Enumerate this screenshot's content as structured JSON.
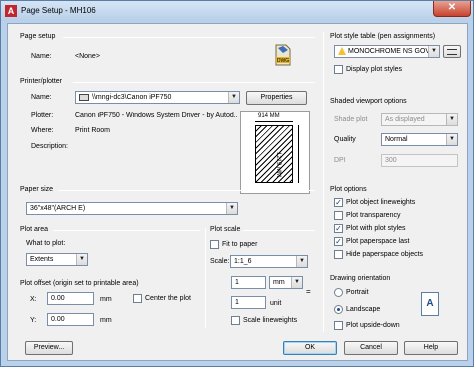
{
  "window": {
    "app_icon": "A",
    "title": "Page Setup - MH106",
    "close_icon": "✕"
  },
  "page_setup": {
    "group_title": "Page setup",
    "name_label": "Name:",
    "name_value": "<None>",
    "dwg_icon_text": "DWG"
  },
  "printer": {
    "group_title": "Printer/plotter",
    "name_label": "Name:",
    "name_value": "\\\\mngi-dc3\\Canon iPF750",
    "properties_label": "Properties",
    "plotter_label": "Plotter:",
    "plotter_value": "Canon iPF750 - Windows System Driver - by Autod...",
    "where_label": "Where:",
    "where_value": "Print Room",
    "description_label": "Description:",
    "dim_width": "914 MM",
    "dim_height": "1219 MM"
  },
  "paper_size": {
    "group_title": "Paper size",
    "value": "36\"x48\"(ARCH E)"
  },
  "plot_area": {
    "group_title": "Plot area",
    "what_label": "What to plot:",
    "what_value": "Extents"
  },
  "plot_offset": {
    "group_title": "Plot offset (origin set to printable area)",
    "x_label": "X:",
    "x_value": "0.00",
    "x_unit": "mm",
    "y_label": "Y:",
    "y_value": "0.00",
    "y_unit": "mm",
    "center_label": "Center the plot"
  },
  "plot_scale": {
    "group_title": "Plot scale",
    "fit_label": "Fit to paper",
    "scale_label": "Scale:",
    "scale_value": "1:1_6",
    "value1": "1",
    "unit1": "mm",
    "equals": "=",
    "value2": "1",
    "unit2": "unit",
    "lineweights_label": "Scale lineweights"
  },
  "plot_style_table": {
    "group_title": "Plot style table (pen assignments)",
    "value": "MONOCHROME NS GOV",
    "display_label": "Display plot styles"
  },
  "shaded_viewport": {
    "group_title": "Shaded viewport options",
    "shade_label": "Shade plot",
    "shade_value": "As displayed",
    "quality_label": "Quality",
    "quality_value": "Normal",
    "dpi_label": "DPI",
    "dpi_value": "300"
  },
  "plot_options": {
    "group_title": "Plot options",
    "items": [
      {
        "label": "Plot object lineweights",
        "checked": true
      },
      {
        "label": "Plot transparency",
        "checked": false
      },
      {
        "label": "Plot with plot styles",
        "checked": true
      },
      {
        "label": "Plot paperspace last",
        "checked": true
      },
      {
        "label": "Hide paperspace objects",
        "checked": false
      }
    ]
  },
  "orientation": {
    "group_title": "Drawing orientation",
    "portrait_label": "Portrait",
    "landscape_label": "Landscape",
    "upside_down_label": "Plot upside-down",
    "icon_letter": "A"
  },
  "footer": {
    "preview_label": "Preview...",
    "ok_label": "OK",
    "cancel_label": "Cancel",
    "help_label": "Help"
  }
}
